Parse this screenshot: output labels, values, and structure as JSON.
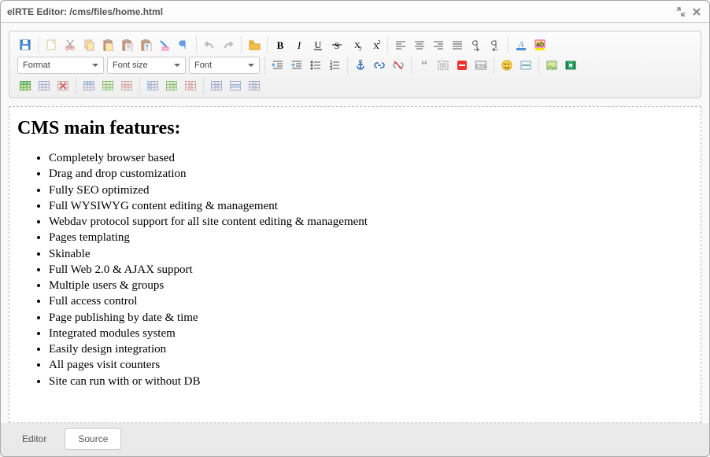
{
  "window": {
    "title": "elRTE Editor: /cms/files/home.html"
  },
  "toolbar": {
    "selects": {
      "format": "Format",
      "fontsize": "Font size",
      "font": "Font"
    },
    "icons": {
      "save": "save",
      "new": "new",
      "cut": "cut",
      "copy": "copy",
      "paste": "paste",
      "paste_formatted": "paste-formatted",
      "paste_text": "paste-text",
      "remove_format": "remove-format",
      "show_blocks": "show-blocks",
      "undo": "undo",
      "redo": "redo",
      "file_manager": "file-manager",
      "bold": "bold",
      "italic": "italic",
      "underline": "underline",
      "strike": "strike",
      "sub": "subscript",
      "sup": "superscript",
      "al_left": "align-left",
      "al_center": "align-center",
      "al_right": "align-right",
      "al_justify": "align-justify",
      "ltr": "ltr",
      "rtl": "rtl",
      "font_color": "font-color",
      "bg_color": "bg-color",
      "outdent": "outdent",
      "indent": "indent",
      "ul": "unordered-list",
      "ol": "ordered-list",
      "anchor": "anchor",
      "link": "link",
      "unlink": "unlink",
      "blockquote": "blockquote",
      "div": "div",
      "stop": "stopfloat",
      "css_class": "css-class",
      "smiley": "smiley",
      "hr": "hr",
      "image": "image",
      "flash": "flash",
      "table": "table",
      "table_props": "table-props",
      "table_delete": "table-delete",
      "row_before": "row-before",
      "row_after": "row-after",
      "row_delete": "row-delete",
      "col_before": "col-before",
      "col_after": "col-after",
      "col_delete": "col-delete",
      "cell_props": "cell-props",
      "merge": "cell-merge",
      "split": "cell-split"
    }
  },
  "document": {
    "heading": "CMS main features:",
    "items": [
      "Completely browser based",
      "Drag and drop customization",
      "Fully SEO optimized",
      "Full WYSIWYG content editing & management",
      "Webdav protocol support for all site content editing & management",
      "Pages templating",
      "Skinable",
      "Full Web 2.0 & AJAX support",
      "Multiple users & groups",
      "Full access control",
      "Page publishing by date & time",
      "Integrated modules system",
      "Easily design integration",
      "All pages visit counters",
      "Site can run with or without DB"
    ]
  },
  "tabs": {
    "editor": "Editor",
    "source": "Source"
  }
}
